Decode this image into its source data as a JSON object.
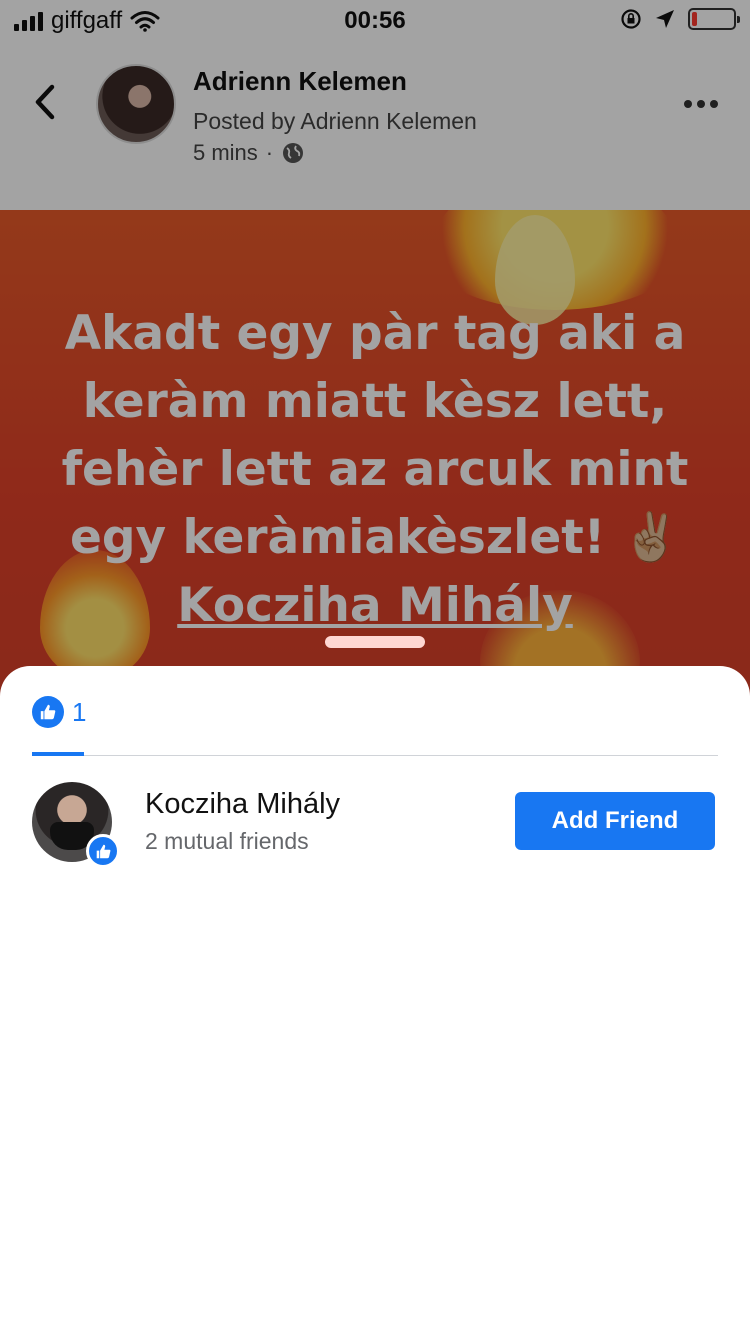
{
  "status_bar": {
    "carrier": "giffgaff",
    "time": "00:56",
    "battery_level": 0.12,
    "battery_color": "#ff3b30"
  },
  "post_header": {
    "back_icon": "chevron-left-icon",
    "author_name": "Adrienn Kelemen",
    "posted_by": "Posted by Adrienn Kelemen",
    "time_ago": "5 mins",
    "separator": "·",
    "privacy_icon": "globe-icon",
    "more_icon": "more-dots-icon"
  },
  "post_image": {
    "text_lines": [
      "Akadt egy pàr tag aki a",
      "keràm miatt kèsz lett,",
      "fehèr lett az arcuk mint",
      "egy keràmiakèszlet!"
    ],
    "emoji": "✌🏼",
    "mention": "Kocziha Mihály",
    "background_color": "#e24a2a"
  },
  "reactions_sheet": {
    "tab_icon": "like-icon",
    "tab_count": "1",
    "accent_color": "#1877f2",
    "people": [
      {
        "name": "Kocziha Mihály",
        "mutual": "2 mutual friends",
        "reaction_icon": "like-icon",
        "action_label": "Add Friend"
      }
    ]
  }
}
